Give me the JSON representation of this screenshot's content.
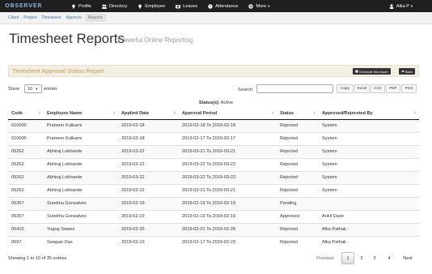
{
  "topbar": {
    "logo": "OBSERVER",
    "nav": [
      {
        "label": "Profile",
        "icon": "lightbulb-icon"
      },
      {
        "label": "Directory",
        "icon": "users-icon"
      },
      {
        "label": "Employee",
        "icon": "lightbulb-icon"
      },
      {
        "label": "Leaves",
        "icon": "camera-icon"
      },
      {
        "label": "Attendance",
        "icon": "clock-icon"
      },
      {
        "label": "More",
        "icon": "plus-circle-icon"
      }
    ],
    "user": "Alka P"
  },
  "subnav": [
    "Client",
    "Project",
    "Timesheet",
    "Approve",
    "Reports"
  ],
  "header": {
    "title": "Timesheet Reports",
    "subtitle": "Powerful Online Reporting."
  },
  "panel": {
    "title": "Timesheet Approval Status Report",
    "schedule_btn": "Schedule this report",
    "back_btn": "Back"
  },
  "controls": {
    "show_label": "Show",
    "show_value": "10",
    "entries_label": "entries",
    "search_label": "Search:",
    "search_value": "",
    "export_buttons": [
      "Copy",
      "Excel",
      "CSV",
      "PDF",
      "Print"
    ]
  },
  "status": {
    "label": "Status(s):",
    "value": "Active"
  },
  "table": {
    "columns": [
      "Code",
      "Employee Name",
      "Applied Date",
      "Approval Period",
      "Status",
      "Approved/Rejeceted By"
    ],
    "rows": [
      [
        "010000",
        "Prameer Kulkarni",
        "2019-02-18",
        "2019-02-18 To 2019-02-18",
        "Rejected",
        "System"
      ],
      [
        "010000",
        "Prameer Kulkarni",
        "2019-02-18",
        "2019-02-17 To 2019-02-17",
        "Rejected",
        "System"
      ],
      [
        "05262",
        "Abhiraj Lokhande",
        "2019-03-22",
        "2019-03-21 To 2019-03-21",
        "Rejected",
        "System"
      ],
      [
        "05262",
        "Abhiraj Lokhande",
        "2019-03-22",
        "2019-03-22 To 2019-03-22",
        "Rejected",
        "System"
      ],
      [
        "05262",
        "Abhiraj Lokhande",
        "2019-03-22",
        "2019-03-22 To 2019-03-22",
        "Rejected",
        "System"
      ],
      [
        "05262",
        "Abhiraj Lokhande",
        "2019-03-22",
        "2019-03-21 To 2019-03-21",
        "Rejected",
        "System"
      ],
      [
        "05357",
        "Surekha Gonsalves",
        "2019-02-19",
        "2019-02-19 To 2019-02-19",
        "Pending",
        ""
      ],
      [
        "05357",
        "Surekha Gonsalves",
        "2019-02-19",
        "2019-02-19 To 2019-02-19",
        "Approved",
        "Ankit Dave"
      ],
      [
        "05410",
        "Yograj Swami",
        "2019-02-25",
        "2019-02-01 To 2019-02-28",
        "Rejected",
        "Alka Pathak"
      ],
      [
        "0697",
        "Swapan Das",
        "2019-02-19",
        "2019-02-17 To 2019-02-23",
        "Rejected",
        "Alka Pathak"
      ]
    ]
  },
  "footer": {
    "info": "Showing 1 to 10 of 35 entries",
    "previous": "Previous",
    "pages": [
      "1",
      "2",
      "3",
      "4"
    ],
    "next": "Next"
  },
  "colors": {
    "topbar": "#1f1f1f",
    "panel_title": "#c29a55",
    "link": "#337ab7"
  }
}
